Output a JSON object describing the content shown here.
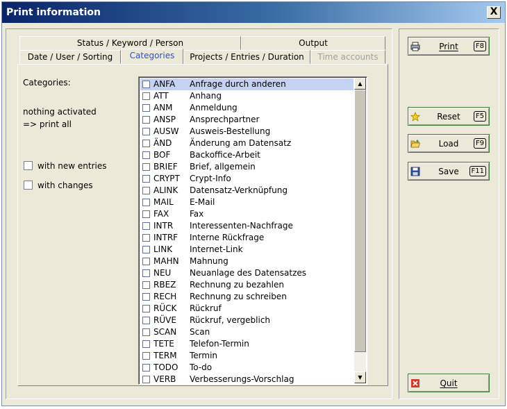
{
  "window": {
    "title": "Print information",
    "close_label": "X"
  },
  "tabs_row1": [
    "Status / Keyword / Person",
    "Output"
  ],
  "tabs_row2": [
    "Date / User / Sorting",
    "Categories",
    "Projects / Entries / Duration",
    "Time accounts"
  ],
  "active_tab": "Categories",
  "categories_panel": {
    "label": "Categories:",
    "status_line1": "nothing activated",
    "status_line2": "=> print all",
    "with_new_entries": "with new entries",
    "with_changes": "with changes"
  },
  "category_items": [
    {
      "code": "ANFA",
      "desc": "Anfrage durch anderen",
      "selected": true
    },
    {
      "code": "ATT",
      "desc": "Anhang"
    },
    {
      "code": "ANM",
      "desc": "Anmeldung"
    },
    {
      "code": "ANSP",
      "desc": "Ansprechpartner"
    },
    {
      "code": "AUSW",
      "desc": "Ausweis-Bestellung"
    },
    {
      "code": "ÄND",
      "desc": "Änderung am Datensatz"
    },
    {
      "code": "BOF",
      "desc": "Backoffice-Arbeit"
    },
    {
      "code": "BRIEF",
      "desc": "Brief, allgemein"
    },
    {
      "code": "CRYPT",
      "desc": "Crypt-Info"
    },
    {
      "code": "ALINK",
      "desc": "Datensatz-Verknüpfung"
    },
    {
      "code": "MAIL",
      "desc": "E-Mail"
    },
    {
      "code": "FAX",
      "desc": "Fax"
    },
    {
      "code": "INTR",
      "desc": "Interessenten-Nachfrage"
    },
    {
      "code": "INTRF",
      "desc": "Interne Rückfrage"
    },
    {
      "code": "LINK",
      "desc": "Internet-Link"
    },
    {
      "code": "MAHN",
      "desc": "Mahnung"
    },
    {
      "code": "NEU",
      "desc": "Neuanlage des Datensatzes"
    },
    {
      "code": "RBEZ",
      "desc": "Rechnung zu bezahlen"
    },
    {
      "code": "RECH",
      "desc": "Rechnung zu schreiben"
    },
    {
      "code": "RÜCK",
      "desc": "Rückruf"
    },
    {
      "code": "RÜVE",
      "desc": "Rückruf, vergeblich"
    },
    {
      "code": "SCAN",
      "desc": "Scan"
    },
    {
      "code": "TETE",
      "desc": "Telefon-Termin"
    },
    {
      "code": "TERM",
      "desc": "Termin"
    },
    {
      "code": "TODO",
      "desc": "To-do"
    },
    {
      "code": "VERB",
      "desc": "Verbesserungs-Vorschlag"
    }
  ],
  "buttons": {
    "print": {
      "label": "Print",
      "key": "F8",
      "icon": "printer-icon"
    },
    "reset": {
      "label": "Reset",
      "key": "F5",
      "icon": "star-icon"
    },
    "load": {
      "label": "Load",
      "key": "F9",
      "icon": "folder-open-icon"
    },
    "save": {
      "label": "Save",
      "key": "F11",
      "icon": "floppy-disk-icon"
    },
    "quit": {
      "label": "Quit",
      "icon": "close-icon"
    }
  },
  "colors": {
    "active_tab_text": "#2d50c8",
    "selected_row": "#c6d2f4",
    "disabled_tab_text": "#a0a0a0"
  }
}
